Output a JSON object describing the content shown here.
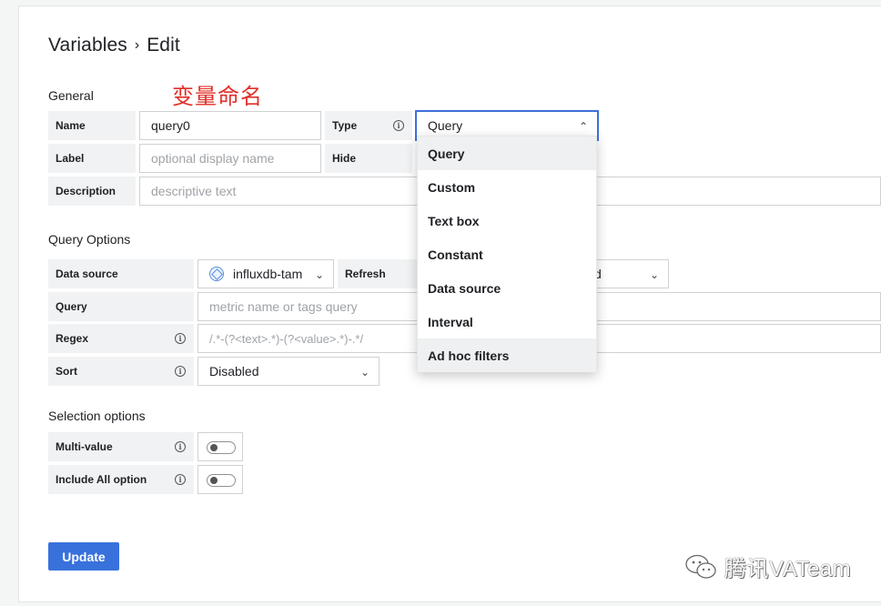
{
  "header": {
    "breadcrumb_root": "Variables",
    "separator": "›",
    "breadcrumb_current": "Edit"
  },
  "annotation": "变量命名",
  "general": {
    "section_title": "General",
    "name_label": "Name",
    "name_value": "query0",
    "type_label": "Type",
    "type_value": "Query",
    "label_label": "Label",
    "label_placeholder": "optional display name",
    "hide_label": "Hide",
    "description_label": "Description",
    "description_placeholder": "descriptive text"
  },
  "type_dropdown": {
    "options": [
      "Query",
      "Custom",
      "Text box",
      "Constant",
      "Data source",
      "Interval",
      "Ad hoc filters"
    ],
    "selected": "Query",
    "hovered": "Ad hoc filters"
  },
  "query_options": {
    "section_title": "Query Options",
    "datasource_label": "Data source",
    "datasource_value": "influxdb-tam",
    "refresh_label": "Refresh",
    "refresh_value_partial": "d",
    "query_label": "Query",
    "query_placeholder": "metric name or tags query",
    "regex_label": "Regex",
    "regex_placeholder": "/.*-(?<text>.*)-(?<value>.*)-.*/",
    "sort_label": "Sort",
    "sort_value": "Disabled"
  },
  "selection_options": {
    "section_title": "Selection options",
    "multi_value_label": "Multi-value",
    "multi_value_on": false,
    "include_all_label": "Include All option",
    "include_all_on": false
  },
  "actions": {
    "update_label": "Update"
  },
  "watermark": {
    "text": "腾讯VATeam"
  },
  "icons": {
    "info": "info-icon",
    "chevron": "chevron-down-icon",
    "chevron_up": "chevron-up-icon",
    "datasource": "influxdb-icon",
    "wechat": "wechat-icon"
  },
  "colors": {
    "primary": "#3871dc",
    "focus": "#3d71d9",
    "annotation": "#e02f2a",
    "label_bg": "#f1f2f3"
  }
}
